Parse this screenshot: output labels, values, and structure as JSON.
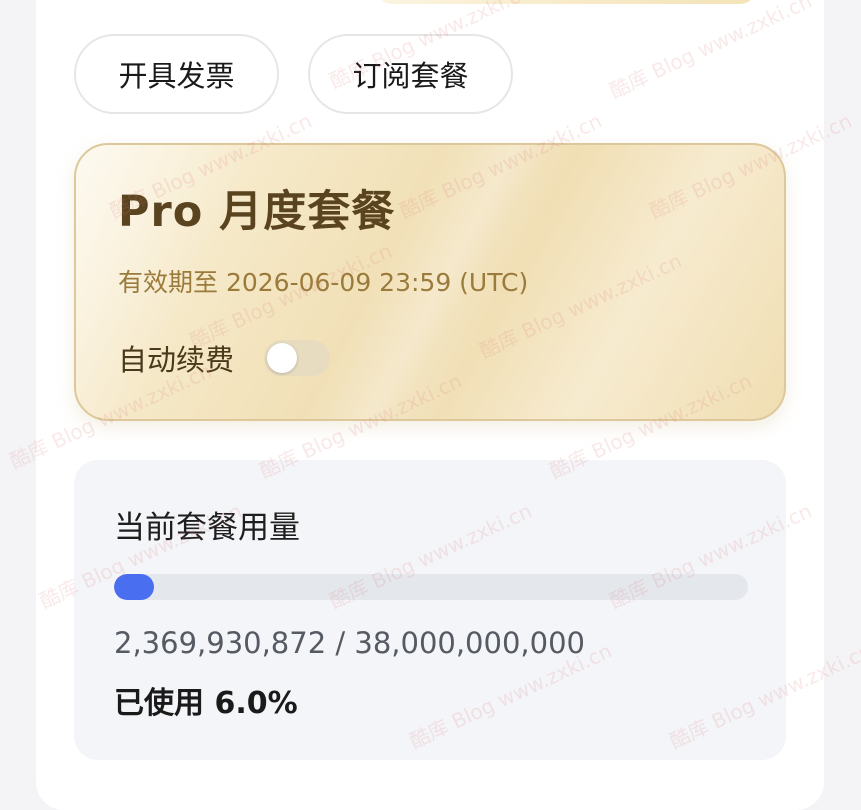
{
  "actions": {
    "invoice_label": "开具发票",
    "subscribe_label": "订阅套餐"
  },
  "plan": {
    "title": "Pro 月度套餐",
    "expiry": "有效期至 2026-06-09 23:59 (UTC)",
    "auto_renew_label": "自动续费",
    "auto_renew_enabled": false
  },
  "usage": {
    "title": "当前套餐用量",
    "count_text": "2,369,930,872 / 38,000,000,000",
    "percent_text": "已使用 6.0%",
    "used_fraction": 0.0624,
    "used": 2369930872,
    "total": 38000000000
  },
  "watermark_text": "酷库 Blog www.zxki.cn",
  "colors": {
    "accent": "#4a6ef0",
    "plan_text": "#5a4420",
    "plan_subtext": "#9a7b3c"
  }
}
